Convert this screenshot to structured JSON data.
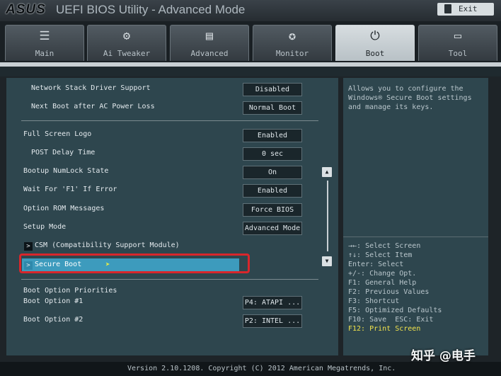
{
  "header": {
    "logo": "ASUS",
    "title": "UEFI BIOS Utility - Advanced Mode",
    "exit_label": "Exit"
  },
  "tabs": [
    {
      "label": "Main",
      "icon": "list-icon"
    },
    {
      "label": "Ai Tweaker",
      "icon": "tweaker-icon"
    },
    {
      "label": "Advanced",
      "icon": "advanced-icon"
    },
    {
      "label": "Monitor",
      "icon": "monitor-icon"
    },
    {
      "label": "Boot",
      "icon": "power-icon",
      "active": true
    },
    {
      "label": "Tool",
      "icon": "tool-icon"
    }
  ],
  "settings": [
    {
      "label": "Network Stack Driver Support",
      "value": "Disabled"
    },
    {
      "label": "Next Boot after AC Power Loss",
      "value": "Normal Boot"
    },
    {
      "label": "Full Screen Logo",
      "value": "Enabled"
    },
    {
      "label": "POST Delay Time",
      "value": "0 sec"
    },
    {
      "label": "Bootup NumLock State",
      "value": "On"
    },
    {
      "label": "Wait For 'F1' If Error",
      "value": "Enabled"
    },
    {
      "label": "Option ROM Messages",
      "value": "Force BIOS"
    },
    {
      "label": "Setup Mode",
      "value": "Advanced Mode"
    }
  ],
  "submenus": {
    "csm": "CSM (Compatibility Support Module)",
    "secure_boot": "Secure Boot"
  },
  "boot_priorities": {
    "heading": "Boot Option Priorities",
    "options": [
      {
        "label": "Boot Option #1",
        "value": "P4: ATAPI ..."
      },
      {
        "label": "Boot Option #2",
        "value": "P2: INTEL ..."
      }
    ]
  },
  "help": {
    "text": "Allows you to configure the Windows® Secure Boot settings and manage its keys."
  },
  "keys": [
    "→←: Select Screen",
    "↑↓: Select Item",
    "Enter: Select",
    "+/-: Change Opt.",
    "F1: General Help",
    "F2: Previous Values",
    "F5: Optimized Defaults",
    "F10: Save  ESC: Exit",
    "F12: Print Screen"
  ],
  "keys_extra": "F3: Shortcut",
  "footer": {
    "copyright": "Version 2.10.1208. Copyright (C) 2012 American Megatrends, Inc."
  },
  "watermark": "知乎 @电手"
}
